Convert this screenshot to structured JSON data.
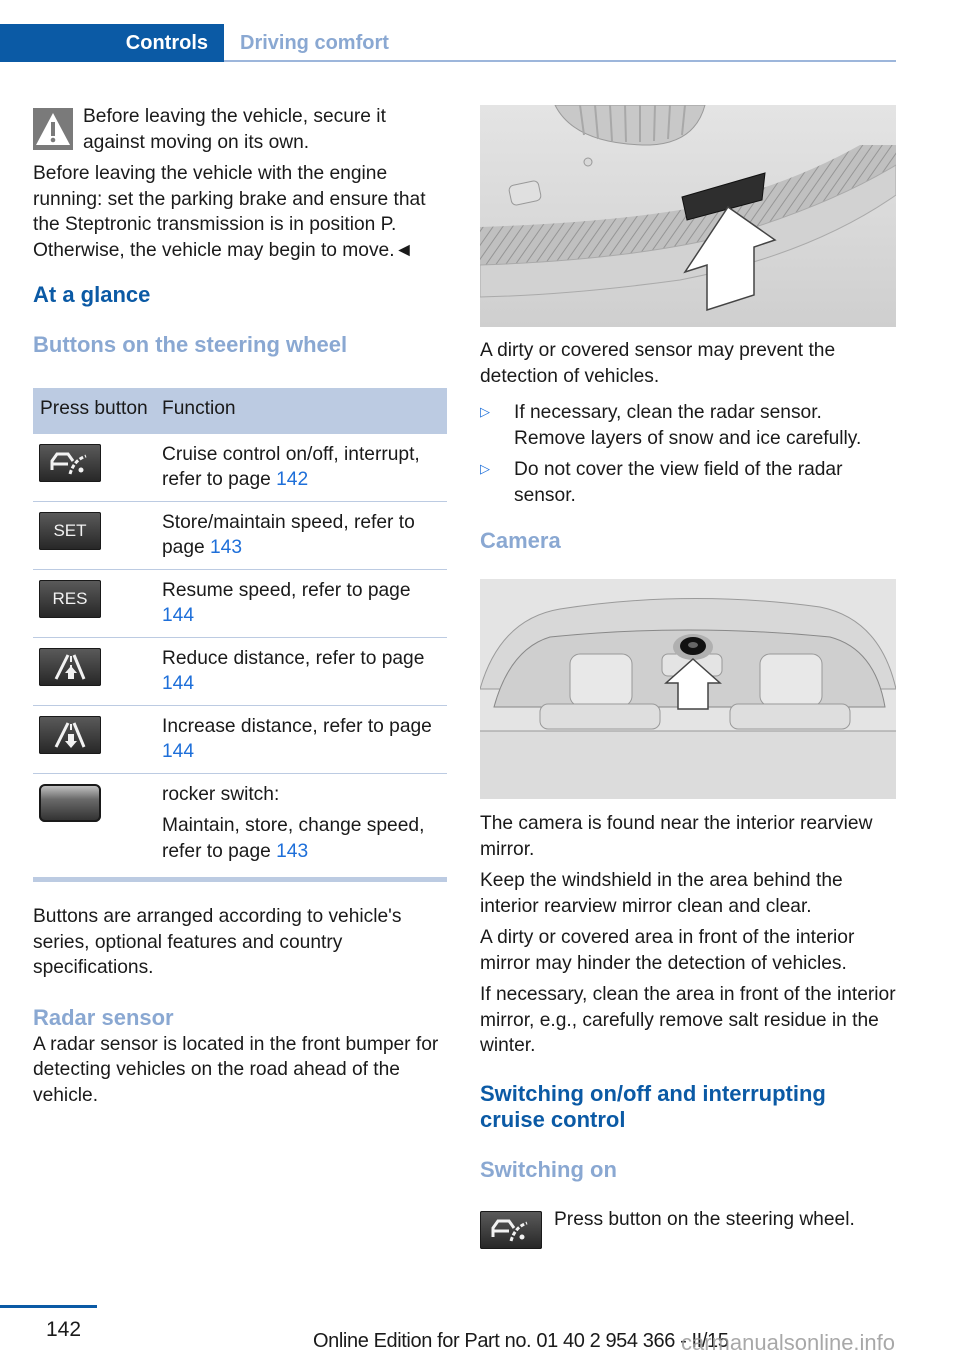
{
  "header": {
    "active_tab": "Controls",
    "inactive_tab": "Driving comfort"
  },
  "warning": {
    "icon": "warning-triangle-icon",
    "text": "Before leaving the vehicle, secure it against moving on its own."
  },
  "left": {
    "para1": "Before leaving the vehicle with the engine running: set the parking brake and ensure that the Steptronic transmission is in position P. Otherwise, the vehicle may begin to move.◄",
    "heading_at_a_glance": "At a glance",
    "heading_buttons": "Buttons on the steering wheel",
    "table": {
      "headers": [
        "Press button",
        "Function"
      ],
      "rows": [
        {
          "icon": "cruise-control-icon",
          "label": "",
          "text": "Cruise control on/off, interrupt, refer to page ",
          "page": "142"
        },
        {
          "icon": "set-button-icon",
          "label": "SET",
          "text": "Store/maintain speed, refer to page ",
          "page": "143"
        },
        {
          "icon": "res-button-icon",
          "label": "RES",
          "text": "Resume speed, refer to page ",
          "page": "144"
        },
        {
          "icon": "reduce-distance-icon",
          "label": "",
          "text": "Reduce distance, refer to page ",
          "page": "144"
        },
        {
          "icon": "increase-distance-icon",
          "label": "",
          "text": "Increase distance, refer to page ",
          "page": "144"
        },
        {
          "icon": "rocker-switch-icon",
          "label": "",
          "text_title": "rocker switch:",
          "text": "Maintain, store, change speed, refer to page ",
          "page": "143"
        }
      ]
    },
    "para_buttons": "Buttons are arranged according to vehicle's series, optional features and country specifications.",
    "heading_radar": "Radar sensor",
    "para_radar": "A radar sensor is located in the front bumper for detecting vehicles on the road ahead of the vehicle."
  },
  "right": {
    "figure_radar": "radar-sensor-bumper-illustration",
    "para_dirty": "A dirty or covered sensor may prevent the detection of vehicles.",
    "bullets": [
      "If necessary, clean the radar sensor. Remove layers of snow and ice carefully.",
      "Do not cover the view field of the radar sensor."
    ],
    "heading_camera": "Camera",
    "figure_camera": "camera-windshield-illustration",
    "camera_paras": [
      "The camera is found near the interior rearview mirror.",
      "Keep the windshield in the area behind the interior rearview mirror clean and clear.",
      "A dirty or covered area in front of the interior mirror may hinder the detection of vehicles.",
      "If necessary, clean the area in front of the interior mirror, e.g., carefully remove salt residue in the winter."
    ],
    "heading_switching": "Switching on/off and interrupting cruise control",
    "heading_switching_on": "Switching on",
    "switching_on_text": "Press button on the steering wheel."
  },
  "footer": {
    "page_number": "142",
    "edition": "Online Edition for Part no. 01 40 2 954 366 - II/15",
    "watermark": "carmanualsonline.info"
  },
  "colors": {
    "brand_blue": "#0b5aa5",
    "subheading_blue": "#8aa8d2",
    "table_header_bg": "#bccbe2",
    "link_blue": "#1e6fd9"
  }
}
